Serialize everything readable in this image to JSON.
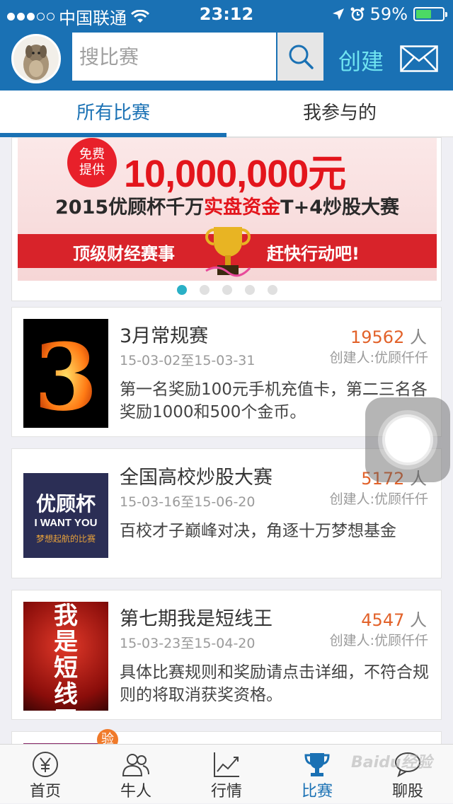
{
  "status_bar": {
    "carrier": "中国联通",
    "time": "23:12",
    "battery": "59%",
    "battery_level": 0.59
  },
  "header": {
    "search_placeholder": "搜比赛",
    "create_label": "创建"
  },
  "tabs": [
    {
      "label": "所有比赛",
      "active": true
    },
    {
      "label": "我参与的",
      "active": false
    }
  ],
  "banner": {
    "badge_line1": "免费",
    "badge_line2": "提供",
    "amount": "10,000,000元",
    "subtitle_prefix": "2015优顾杯千万",
    "subtitle_highlight": "实盘资金",
    "subtitle_suffix": "T+4炒股大赛",
    "strip_left": "顶级财经赛事",
    "strip_right": "赶快行动吧!",
    "page_count": 5,
    "active_page": 0
  },
  "contests": [
    {
      "thumb_text": "3",
      "title": "3月常规赛",
      "count": "19562",
      "count_unit": "人",
      "dates": "15-03-02至15-03-31",
      "creator": "创建人:优顾仟仟",
      "description": "第一名奖励100元手机充值卡，第二三名各奖励1000和500个金币。"
    },
    {
      "thumb_line1": "优顾杯",
      "thumb_line2": "I WANT YOU",
      "thumb_line3": "梦想起航的比赛",
      "title": "全国高校炒股大赛",
      "count": "5172",
      "count_unit": "人",
      "dates": "15-03-16至15-06-20",
      "creator": "创建人:优顾仟仟",
      "description": "百校才子巅峰对决，角逐十万梦想基金"
    },
    {
      "thumb_text": "我是短线王",
      "title": "第七期我是短线王",
      "count": "4547",
      "count_unit": "人",
      "dates": "15-03-23至15-04-20",
      "creator": "创建人:优顾仟仟",
      "description": "具体比赛规则和奖励请点击详细，不符合规则的将取消获奖资格。"
    }
  ],
  "partial_badge": "验",
  "bottom_nav": [
    {
      "label": "首页",
      "icon": "yen-icon",
      "active": false
    },
    {
      "label": "牛人",
      "icon": "users-icon",
      "active": false
    },
    {
      "label": "行情",
      "icon": "chart-icon",
      "active": false
    },
    {
      "label": "比赛",
      "icon": "trophy-icon",
      "active": true
    },
    {
      "label": "聊股",
      "icon": "chat-icon",
      "active": false
    }
  ],
  "watermark": "Baidu经验",
  "colors": {
    "primary": "#1a71b4",
    "create": "#6fe3f0",
    "count": "#e2622a",
    "banner_red": "#e3151c",
    "pager_active": "#2ab0c6"
  }
}
